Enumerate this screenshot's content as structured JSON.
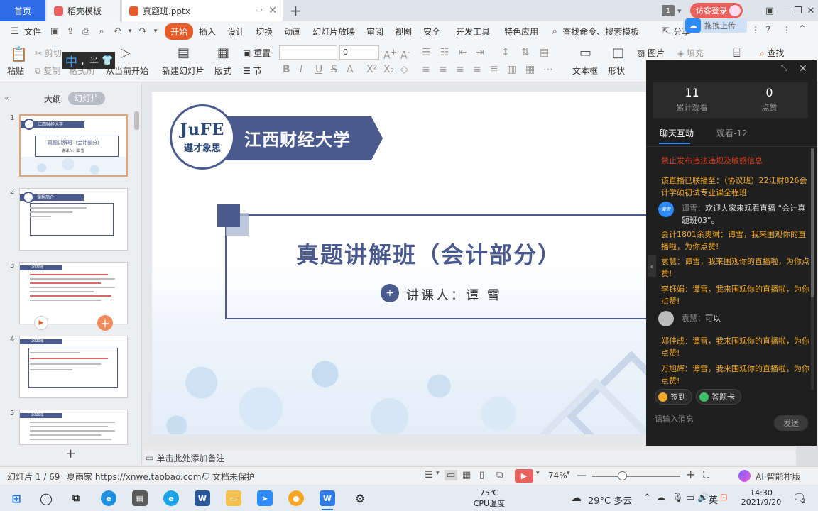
{
  "tabs": {
    "home": "首页",
    "template": "稻壳模板",
    "file": "真题班.pptx",
    "badge": "1",
    "login": "访客登录"
  },
  "menu": {
    "file": "文件",
    "items": [
      "开始",
      "插入",
      "设计",
      "切换",
      "动画",
      "幻灯片放映",
      "审阅",
      "视图",
      "安全",
      "开发工具",
      "特色应用"
    ],
    "search": "查找命令、搜索模板",
    "share": "分享",
    "upload": "拖拽上传",
    "help": "?"
  },
  "ribbon": {
    "paste": "粘贴",
    "cut": "剪切",
    "copy": "复制",
    "format_painter": "格式刷",
    "from_current": "从当前开始",
    "new_slide": "新建幻灯片",
    "layout": "版式",
    "reset": "重置",
    "section": "节",
    "font_size": "0",
    "textbox": "文本框",
    "shape": "形状",
    "picture": "图片",
    "fill": "填充",
    "find": "查找",
    "ime_text": "，半"
  },
  "left_panel": {
    "tab_outline": "大纲",
    "tab_slides": "幻灯片",
    "thumbs": [
      {
        "num": "1",
        "band": "江西财经大学",
        "title": "真题讲解班（会计部分）",
        "sub": "讲课人：谭 雪"
      },
      {
        "num": "2",
        "band": "课程简介"
      },
      {
        "num": "3",
        "band": "2020年"
      },
      {
        "num": "4",
        "band": "2020年"
      },
      {
        "num": "5",
        "band": "2020年"
      }
    ],
    "add": "+"
  },
  "slide": {
    "logo_mark": "JuFE",
    "logo_sub": "遵才象思",
    "university": "江西财经大学",
    "title": "真题讲解班（会计部分）",
    "lecturer": "讲课人：谭 雪"
  },
  "notes": "单击此处添加备注",
  "chat": {
    "views": "11",
    "views_label": "累计观看",
    "likes": "0",
    "likes_label": "点赞",
    "tab_chat": "聊天互动",
    "tab_viewers": "观看-12",
    "messages": [
      {
        "text": "禁止发布违法违规及敏感信息",
        "color": "red"
      },
      {
        "text": "该直播已联播至：（协议班）22江财826会计学硕初试专业课全程班",
        "color": "orange"
      },
      {
        "name": "谭雪：",
        "text": "欢迎大家来观看直播 “会计真题班03”。",
        "color": "white",
        "avatar": "谭雪"
      },
      {
        "text": "会计1801余奥琳：谭雪，我来围观你的直播啦，为你点赞!",
        "color": "orange"
      },
      {
        "text": "袁慧：谭雪，我来围观你的直播啦，为你点赞!",
        "color": "orange"
      },
      {
        "text": "李钰娟：谭雪，我来围观你的直播啦，为你点赞!",
        "color": "orange"
      },
      {
        "name": "袁慧：",
        "text": "可以",
        "color": "white"
      },
      {
        "text": "郑佳成：谭雪，我来围观你的直播啦，为你点赞!",
        "color": "orange"
      },
      {
        "text": "万旭辉：谭雪，我来围观你的直播啦，为你点赞!",
        "color": "orange"
      }
    ],
    "checkin": "签到",
    "answer_card": "答题卡",
    "input_placeholder": "请输入消息",
    "send": "发送"
  },
  "statusbar": {
    "slide_info": "幻灯片 1 / 69",
    "shop": "夏雨家 https://xnwe.taobao.com/",
    "protect": "文档未保护",
    "zoom": "74%",
    "ai": "AI·智能排版"
  },
  "taskbar": {
    "cpu_temp": "75℃",
    "cpu_label": "CPU温度",
    "weather": "29°C 多云",
    "lang": "英",
    "time": "14:30",
    "date": "2021/9/20",
    "notif": "2"
  },
  "colors": {
    "accent": "#e85c2a",
    "brand_navy": "#4a5a8c",
    "wps_blue": "#2e6be6",
    "chat_bg": "#1f1f1f",
    "chat_orange": "#f0a828",
    "chat_red": "#e64b2e"
  }
}
